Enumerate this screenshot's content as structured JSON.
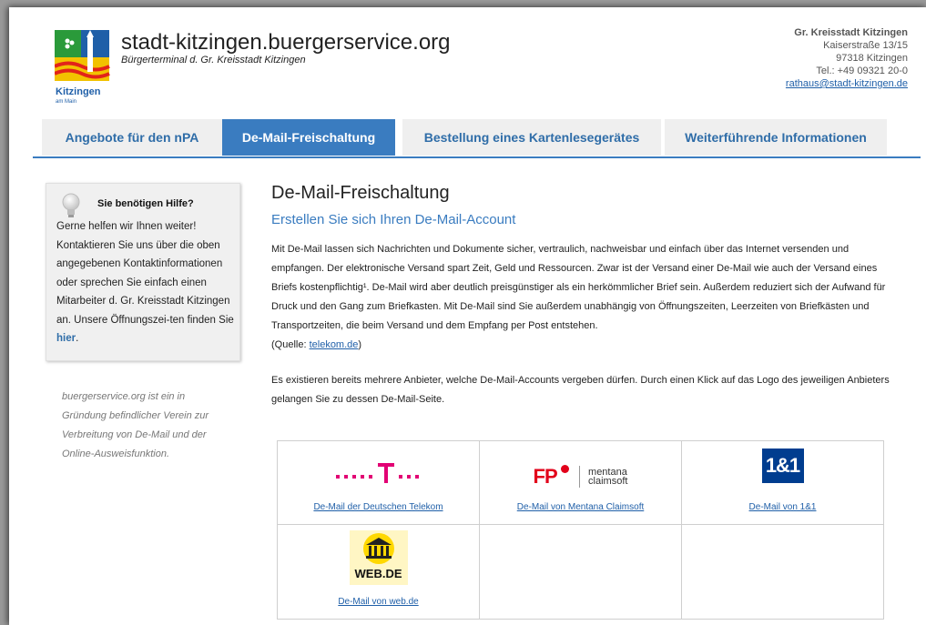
{
  "header": {
    "logo_text": "Kitzingen",
    "logo_subtext": "am Main",
    "site_title": "stadt-kitzingen.buergerservice.org",
    "site_subtitle": "Bürgerterminal d. Gr. Kreisstadt Kitzingen"
  },
  "contact": {
    "org": "Gr. Kreisstadt Kitzingen",
    "street": "Kaiserstraße 13/15",
    "city": "97318 Kitzingen",
    "phone": "Tel.: +49 09321 20-0",
    "email": "rathaus@stadt-kitzingen.de"
  },
  "nav": {
    "tabs": [
      {
        "label": "Angebote für den nPA",
        "active": false
      },
      {
        "label": "De-Mail-Freischaltung",
        "active": true
      },
      {
        "label": "Bestellung eines Kartenlesegerätes",
        "active": false
      },
      {
        "label": "Weiterführende Informationen",
        "active": false
      }
    ]
  },
  "sidebar": {
    "help_title": "Sie benötigen Hilfe?",
    "help_text_before_link": "Gerne helfen wir Ihnen weiter! Kontaktieren Sie uns über die oben angegebenen Kontaktinformationen oder sprechen Sie einfach einen Mitarbeiter d. Gr. Kreisstadt Kitzingen an. Unsere Öffnungszei-ten finden Sie",
    "help_link": "hier",
    "help_text_after_link": ".",
    "verein_text": "buergerservice.org ist ein in Gründung befindlicher Verein zur Verbreitung von De-Mail und der Online-Ausweisfunktion."
  },
  "main": {
    "title": "De-Mail-Freischaltung",
    "subtitle": "Erstellen Sie sich Ihren De-Mail-Account",
    "paragraph1": "Mit De-Mail lassen sich Nachrichten und Dokumente sicher, vertraulich, nachweisbar und einfach über das Internet versenden und empfangen. Der elektronische Versand spart Zeit, Geld und Ressourcen. Zwar ist der Versand einer De-Mail wie auch der Versand eines Briefs kostenpflichtig¹. De-Mail wird aber deutlich preisgünstiger als ein herkömmlicher Brief sein. Außerdem reduziert sich der Aufwand für Druck und den Gang zum Briefkasten. Mit De-Mail sind Sie außerdem unabhängig von Öffnungszeiten, Leerzeiten von Briefkästen und Transportzeiten, die beim Versand und dem Empfang per Post entstehen.",
    "source_prefix": "(Quelle: ",
    "source_link": "telekom.de",
    "source_suffix": ")",
    "paragraph2": "Es existieren bereits mehrere Anbieter, welche De-Mail-Accounts vergeben dürfen. Durch einen Klick auf das Logo des jeweiligen Anbieters gelangen Sie zu dessen De-Mail-Seite."
  },
  "providers": [
    {
      "name": "De-Mail der Deutschen Telekom",
      "logo_text": "·······T···",
      "icon": "telekom-logo",
      "color": "#e20074"
    },
    {
      "name": "De-Mail von Mentana Claimsoft",
      "logo_text": "FP",
      "logo_text2": "mentana",
      "logo_text3": "claimsoft",
      "icon": "mentana-claimsoft-logo",
      "color": "#e2001a"
    },
    {
      "name": "De-Mail von 1&1",
      "logo_text": "1&1",
      "icon": "1und1-logo",
      "color": "#003d8f"
    },
    {
      "name": "De-Mail von web.de",
      "logo_text": "WEB.DE",
      "icon": "webde-logo",
      "color": "#ffd800"
    }
  ]
}
